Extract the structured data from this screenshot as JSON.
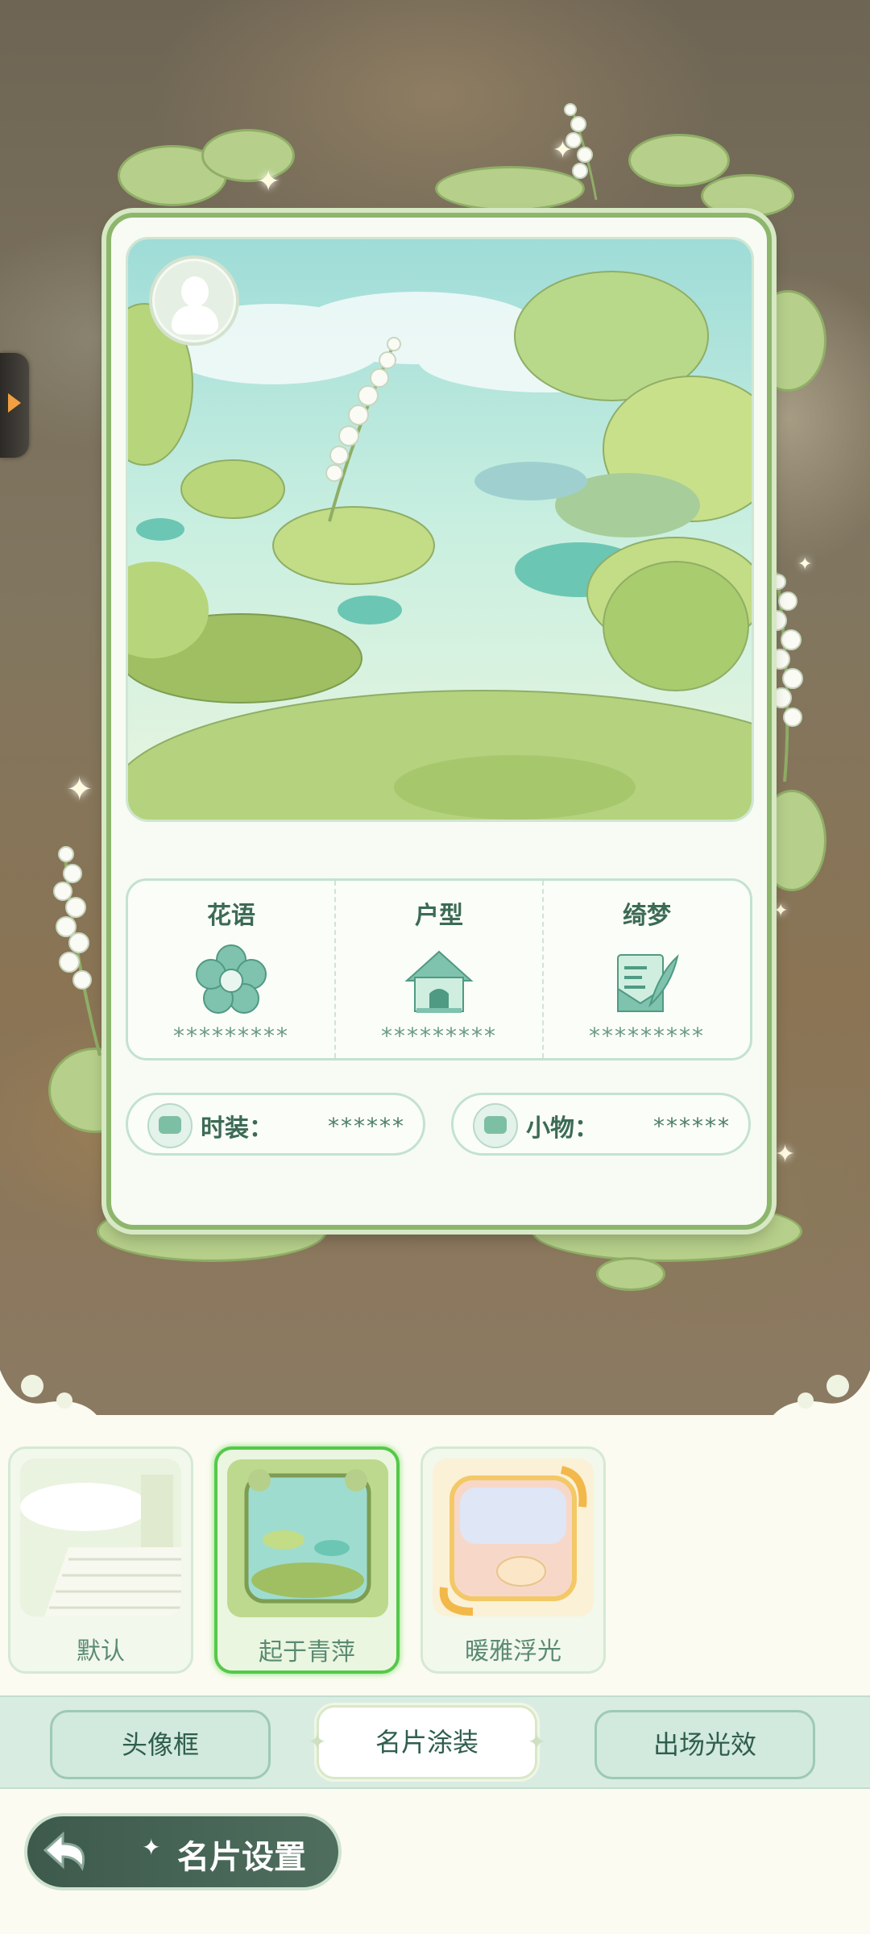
{
  "card": {
    "stats": [
      {
        "label": "花语",
        "value": "*********",
        "icon": "flower-icon"
      },
      {
        "label": "户型",
        "value": "*********",
        "icon": "house-icon"
      },
      {
        "label": "绮梦",
        "value": "*********",
        "icon": "letter-quill-icon"
      }
    ],
    "outfit": {
      "label": "时装：",
      "value": "******",
      "icon": "clothes-icon"
    },
    "item": {
      "label": "小物：",
      "value": "******",
      "icon": "sofa-icon"
    }
  },
  "themes": [
    {
      "label": "默认",
      "selected": false
    },
    {
      "label": "起于青萍",
      "selected": true
    },
    {
      "label": "暖雅浮光",
      "selected": false
    }
  ],
  "tabs": [
    {
      "label": "头像框",
      "active": false
    },
    {
      "label": "名片涂装",
      "active": true
    },
    {
      "label": "出场光效",
      "active": false
    }
  ],
  "footer": {
    "title": "名片设置",
    "back_icon": "back-arrow-icon"
  },
  "colors": {
    "accent": "#55c84a",
    "frame": "#8db66c",
    "tab_bg": "#d8ece2",
    "dark_button": "#3d5a4c"
  }
}
